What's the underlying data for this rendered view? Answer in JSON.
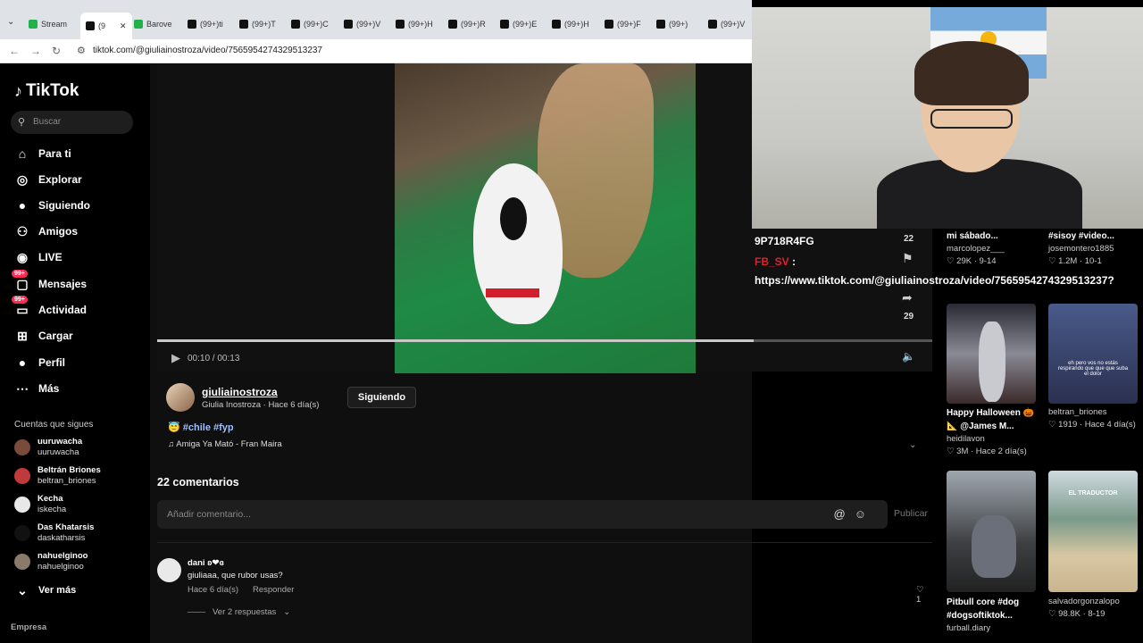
{
  "browser": {
    "tabs": [
      {
        "label": "Stream"
      },
      {
        "label": "(9"
      },
      {
        "label": "Barove"
      },
      {
        "label": "(99+)ti"
      },
      {
        "label": "(99+)T"
      },
      {
        "label": "(99+)C"
      },
      {
        "label": "(99+)V"
      },
      {
        "label": "(99+)H"
      },
      {
        "label": "(99+)R"
      },
      {
        "label": "(99+)E"
      },
      {
        "label": "(99+)H"
      },
      {
        "label": "(99+)F"
      },
      {
        "label": "(99+)"
      },
      {
        "label": "(99+)V"
      }
    ],
    "url": "tiktok.com/@giuliainostroza/video/7565954274329513237"
  },
  "sidebar": {
    "logo": "TikTok",
    "search_placeholder": "Buscar",
    "nav": [
      {
        "label": "Para ti",
        "icon": "home-icon"
      },
      {
        "label": "Explorar",
        "icon": "compass-icon"
      },
      {
        "label": "Siguiendo",
        "icon": "following-avatar-icon"
      },
      {
        "label": "Amigos",
        "icon": "friends-icon"
      },
      {
        "label": "LIVE",
        "icon": "live-icon"
      },
      {
        "label": "Mensajes",
        "icon": "messages-icon",
        "badge": "99+"
      },
      {
        "label": "Actividad",
        "icon": "activity-icon",
        "badge": "99+"
      },
      {
        "label": "Cargar",
        "icon": "upload-icon"
      },
      {
        "label": "Perfil",
        "icon": "profile-icon"
      },
      {
        "label": "Más",
        "icon": "more-icon"
      }
    ],
    "following_title": "Cuentas que sigues",
    "following": [
      {
        "name": "uuruwacha",
        "handle": "uuruwacha",
        "color": "#7a4b3a"
      },
      {
        "name": "Beltrán Briones",
        "handle": "beltran_briones",
        "color": "#c0393b"
      },
      {
        "name": "Kecha",
        "handle": "iskecha",
        "color": "#e8e8e8"
      },
      {
        "name": "Das Khatarsis",
        "handle": "daskatharsis",
        "color": "#111111"
      },
      {
        "name": "nahuelginoo",
        "handle": "nahuelginoo",
        "color": "#8a7a6a"
      }
    ],
    "see_more": "Ver más",
    "footer": "Empresa"
  },
  "video": {
    "time": "00:10 / 00:13",
    "progress": 0.77
  },
  "author": {
    "username": "giuliainostroza",
    "subtitle": "Giulia Inostroza · Hace 6 día(s)",
    "follow_label": "Siguiendo",
    "tags_emoji": "😇",
    "tags": "#chile #fyp",
    "song": "♫ Amiga Ya Mató - Fran Maira"
  },
  "comments": {
    "title": "22 comentarios",
    "placeholder": "Añadir comentario...",
    "publish": "Publicar",
    "items": [
      {
        "user": "dani ʚ❤ɞ",
        "text": "giuliaaa, que rubor usas?",
        "meta": "Hace 6 día(s)",
        "reply": "Responder",
        "likes": "1",
        "more": "Ver 2 respuestas"
      }
    ]
  },
  "overlay": {
    "line1": "9P718R4FG",
    "line2_user": "FB_SV",
    "line2_rest": " :",
    "line3": "https://www.tiktok.com/@giuliainostroza/video/7565954274329513237?",
    "count_top": "22",
    "count_bottom": "29"
  },
  "suggested": [
    {
      "title": "mi sábado...",
      "user": "marcolopez___",
      "stats": "♡ 29K · 9-14"
    },
    {
      "title": "#sisoy #video...",
      "user": "josemontero1885",
      "stats": "♡ 1.2M · 10-1"
    },
    {
      "title": "Happy Halloween 🎃 📐 @James M...",
      "user": "heidilavon",
      "stats": "♡ 3M · Hace 2 día(s)"
    },
    {
      "title": "",
      "user": "beltran_briones",
      "stats": "♡ 1919 · Hace 4 día(s)"
    },
    {
      "title": "Pitbull core #dog #dogsoftiktok...",
      "user": "furball.diary",
      "stats": ""
    },
    {
      "title": "",
      "user": "salvadorgonzalopo",
      "stats": "♡ 98.8K · 8-19"
    }
  ],
  "thumb_texts": {
    "t4_caption": "eh pero vos no estás respirando que que que suba el dolor",
    "t6_caption": "EL TRADUCTOR"
  }
}
